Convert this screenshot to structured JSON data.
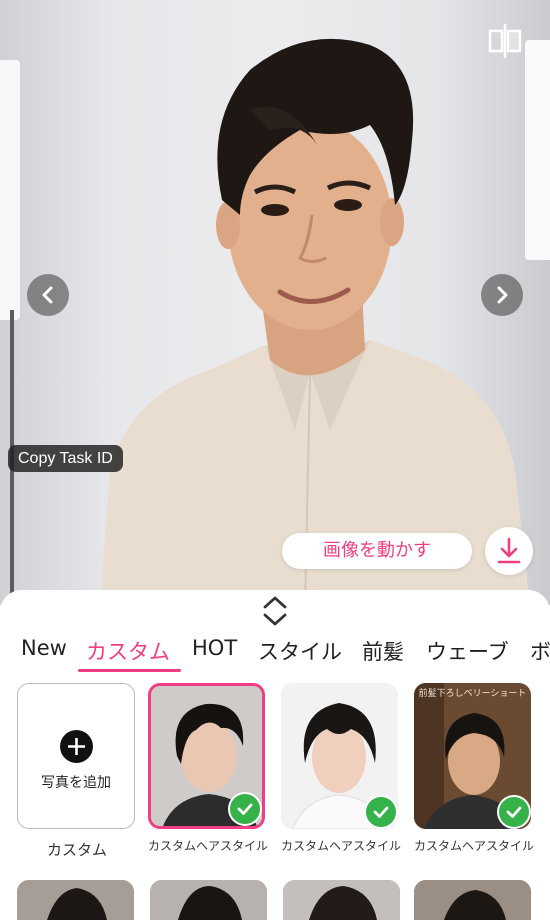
{
  "photo": {
    "copy_task_label": "Copy Task ID",
    "animate_label": "画像を動かす"
  },
  "icons": {
    "compare": "compare-split-icon",
    "prev": "chevron-left-icon",
    "next": "chevron-right-icon",
    "download": "download-icon",
    "expand": "expand-collapse-icon",
    "add": "plus-icon",
    "check": "check-icon"
  },
  "colors": {
    "accent": "#ef3e82",
    "check": "#35b34a"
  },
  "tabs": [
    {
      "label": "New"
    },
    {
      "label": "カスタム",
      "active": true
    },
    {
      "label": "HOT"
    },
    {
      "label": "スタイル"
    },
    {
      "label": "前髪"
    },
    {
      "label": "ウェーブ"
    },
    {
      "label": "ボ"
    }
  ],
  "custom_tile": {
    "add_label": "写真を追加",
    "caption": "カスタム"
  },
  "styles": [
    {
      "caption": "カスタムヘアスタイル",
      "selected": true
    },
    {
      "caption": "カスタムヘアスタイル",
      "selected": false
    },
    {
      "caption": "カスタムヘアスタイル",
      "selected": false,
      "overlay_text": "前髪下ろしベリーショート"
    }
  ]
}
